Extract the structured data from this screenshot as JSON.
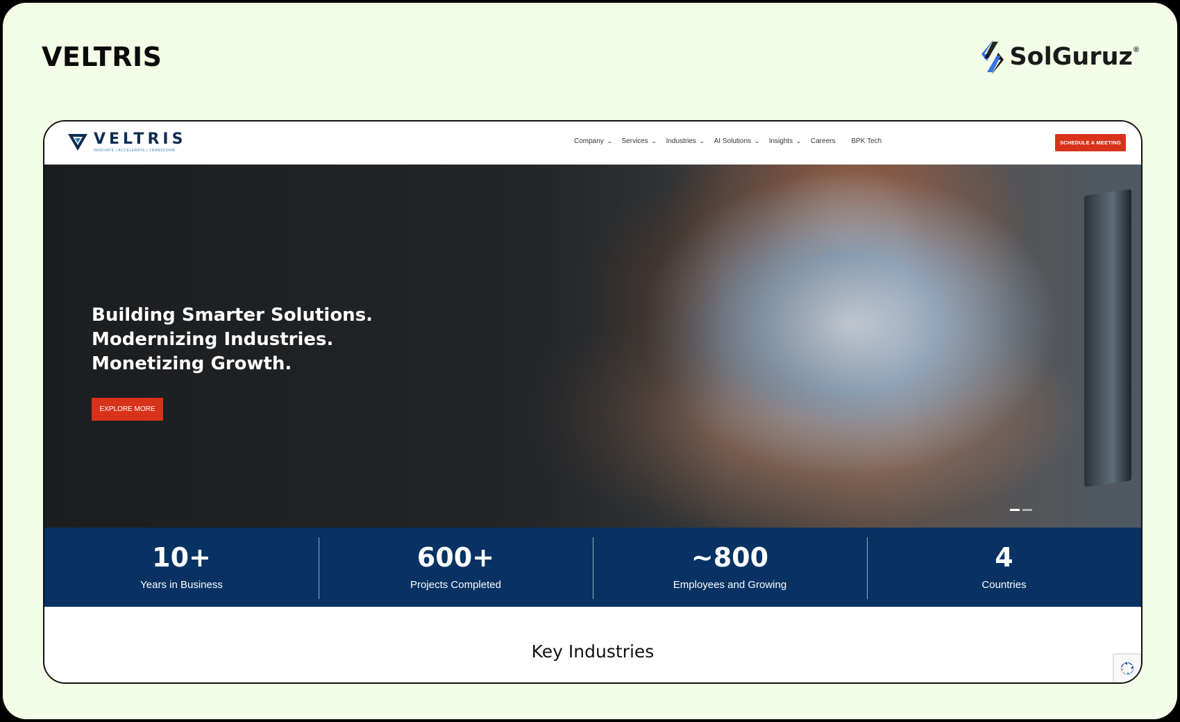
{
  "page": {
    "brand_title": "VELTRIS",
    "solguruz": {
      "name": "SolGuruz",
      "reg": "®"
    }
  },
  "site": {
    "logo": {
      "word": "VELTRIS",
      "tagline": "INNOVATE | ACCELERATE | TRANSFORM"
    },
    "nav": [
      {
        "label": "Company",
        "has_dropdown": true
      },
      {
        "label": "Services",
        "has_dropdown": true
      },
      {
        "label": "Industries",
        "has_dropdown": true
      },
      {
        "label": "AI Solutions",
        "has_dropdown": true
      },
      {
        "label": "Insights",
        "has_dropdown": true
      },
      {
        "label": "Careers",
        "has_dropdown": false
      },
      {
        "label": "BPK Tech",
        "has_dropdown": false
      }
    ],
    "cta": "SCHEDULE A MEETING",
    "hero": {
      "lines": [
        "Building Smarter Solutions.",
        "Modernizing Industries.",
        "Monetizing Growth."
      ],
      "button": "EXPLORE MORE",
      "slide_count": 2,
      "active_slide": 1
    },
    "stats": [
      {
        "value": "10+",
        "label": "Years in Business"
      },
      {
        "value": "600+",
        "label": "Projects Completed"
      },
      {
        "value": "~800",
        "label": "Employees and Growing"
      },
      {
        "value": "4",
        "label": "Countries"
      }
    ],
    "section_heading": "Key Industries"
  },
  "colors": {
    "page_bg": "#f3fce6",
    "accent_red": "#d8321a",
    "stats_blue": "#073263",
    "logo_navy": "#0e2c52"
  },
  "icons": [
    "veltris-logo-icon",
    "solguruz-logo-icon",
    "chevron-down-icon",
    "recaptcha-icon"
  ]
}
